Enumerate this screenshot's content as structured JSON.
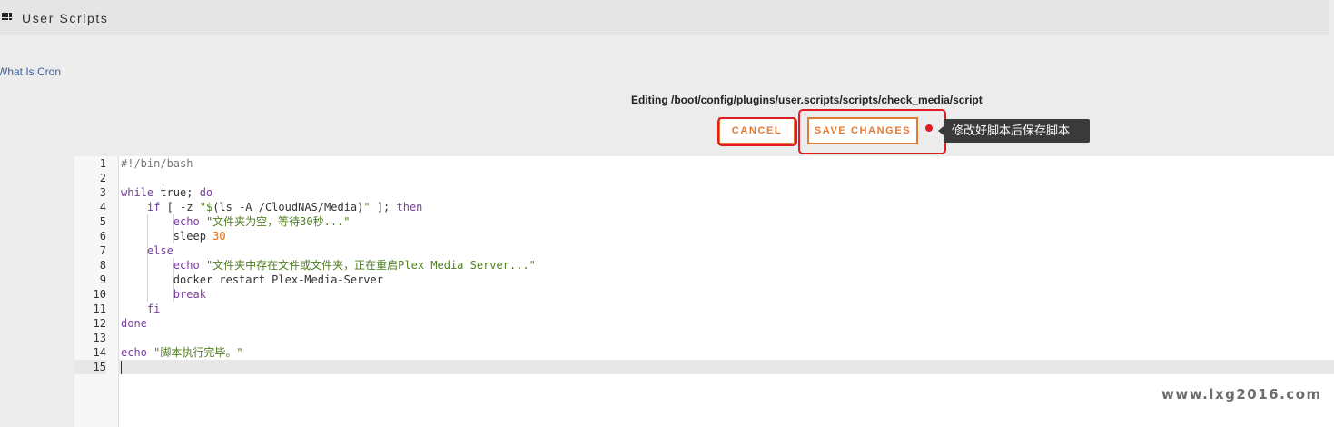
{
  "header": {
    "title": "User Scripts",
    "menu_icon": "grid-icon"
  },
  "links": {
    "what_is_cron": "What Is Cron"
  },
  "editor_path": "Editing /boot/config/plugins/user.scripts/scripts/check_media/script",
  "buttons": {
    "cancel": "CANCEL",
    "save": "SAVE CHANGES"
  },
  "annotation": {
    "tooltip": "修改好脚本后保存脚本",
    "accent_color": "#e01b24"
  },
  "code": {
    "active_line": 15,
    "lines": [
      "#!/bin/bash",
      "",
      "while true; do",
      "    if [ -z \"$(ls -A /CloudNAS/Media)\" ]; then",
      "        echo \"文件夹为空，等待30秒...\"",
      "        sleep 30",
      "    else",
      "        echo \"文件夹中存在文件或文件夹，正在重启Plex Media Server...\"",
      "        docker restart Plex-Media-Server",
      "        break",
      "    fi",
      "done",
      "",
      "echo \"脚本执行完毕。\"",
      ""
    ],
    "line_numbers": [
      "1",
      "2",
      "3",
      "4",
      "5",
      "6",
      "7",
      "8",
      "9",
      "10",
      "11",
      "12",
      "13",
      "14",
      "15"
    ]
  },
  "theme": {
    "button_color": "#e27b34",
    "link_color": "#3b5f9d"
  },
  "watermark": "www.lxg2016.com"
}
